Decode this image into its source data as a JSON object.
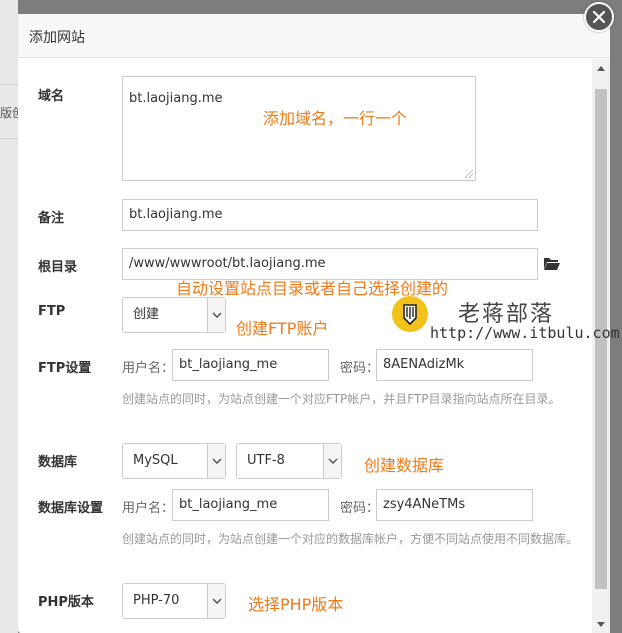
{
  "background": {
    "partial_text": "版创"
  },
  "dialog": {
    "title": "添加网站",
    "form": {
      "domain_label": "域名",
      "domain_value": "bt.laojiang.me",
      "remark_label": "备注",
      "remark_value": "bt.laojiang.me",
      "root_label": "根目录",
      "root_value": "/www/wwwroot/bt.laojiang.me",
      "ftp_label": "FTP",
      "ftp_select": "创建",
      "ftp_settings_label": "FTP设置",
      "ftp_username_label": "用户名：",
      "ftp_username": "bt_laojiang_me",
      "ftp_password_label": "密码：",
      "ftp_password": "8AENAdizMk",
      "ftp_hint": "创建站点的同时，为站点创建一个对应FTP帐户，并且FTP目录指向站点所在目录。",
      "db_label": "数据库",
      "db_type": "MySQL",
      "db_charset": "UTF-8",
      "db_settings_label": "数据库设置",
      "db_username_label": "用户名：",
      "db_username": "bt_laojiang_me",
      "db_password_label": "密码：",
      "db_password": "zsy4ANeTMs",
      "db_hint": "创建站点的同时，为站点创建一个对应的数据库帐户，方便不同站点使用不同数据库。",
      "php_label": "PHP版本",
      "php_version": "PHP-70"
    }
  },
  "annotations": {
    "domain": "添加域名，一行一个",
    "root": "自动设置站点目录或者自己选择创建的",
    "ftp": "创建FTP账户",
    "db": "创建数据库",
    "php": "选择PHP版本"
  },
  "watermark": {
    "name": "老蒋部落",
    "url": "http://www.itbulu.com"
  },
  "colors": {
    "annotation": "#ee7b1a",
    "overlay": "#7d7d7d",
    "watermark_logo": "#f2c21a"
  }
}
